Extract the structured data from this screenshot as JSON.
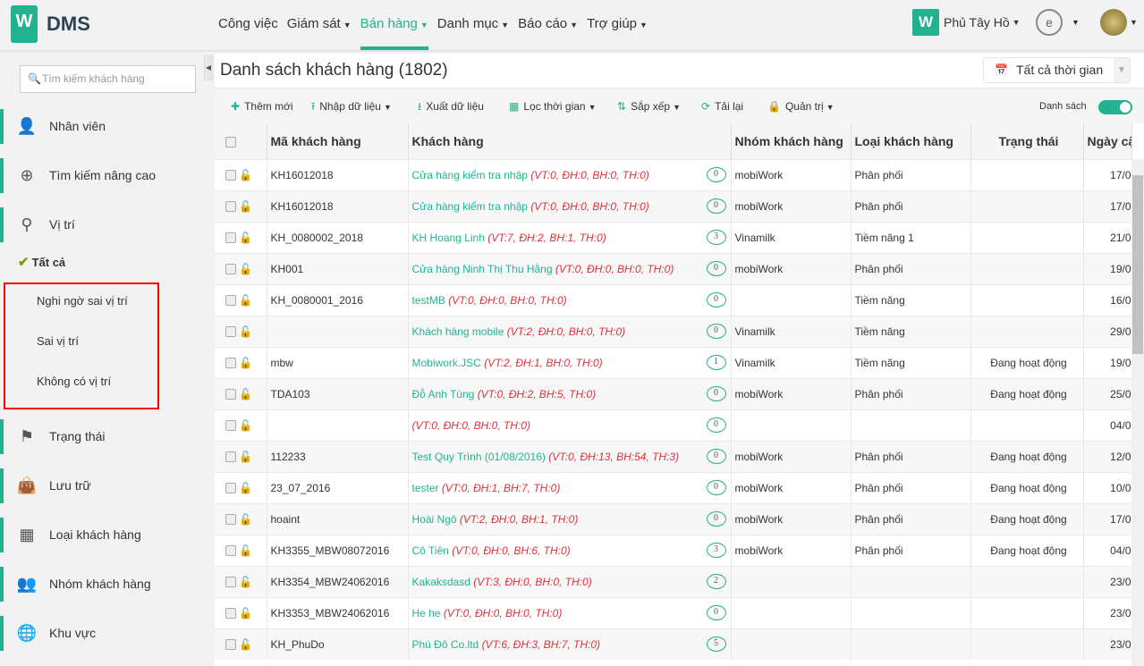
{
  "app": {
    "logo_letter": "W",
    "name": "DMS"
  },
  "nav": [
    {
      "label": "Công việc",
      "dropdown": false
    },
    {
      "label": "Giám sát",
      "dropdown": true
    },
    {
      "label": "Bán hàng",
      "dropdown": true,
      "active": true
    },
    {
      "label": "Danh mục",
      "dropdown": true
    },
    {
      "label": "Báo cáo",
      "dropdown": true
    },
    {
      "label": "Trợ giúp",
      "dropdown": true
    }
  ],
  "account": {
    "company": "Phủ Tây Hồ",
    "partner_logo": "eKGIS_JSC"
  },
  "sidebar": {
    "search_placeholder": "Tìm kiếm khách hàng",
    "items": [
      {
        "label": "Nhân viên",
        "icon": "user-icon"
      },
      {
        "label": "Tìm kiếm nâng cao",
        "icon": "zoom-in-icon"
      },
      {
        "label": "Vị trí",
        "icon": "map-marker-icon"
      },
      {
        "label": "Trạng thái",
        "icon": "flag-icon"
      },
      {
        "label": "Lưu trữ",
        "icon": "shopping-bag-icon"
      },
      {
        "label": "Loại khách hàng",
        "icon": "grid-icon"
      },
      {
        "label": "Nhóm khách hàng",
        "icon": "users-icon"
      },
      {
        "label": "Khu vực",
        "icon": "globe-icon"
      }
    ],
    "location_all": "Tất cả",
    "location_sub": [
      "Nghi ngờ sai vị trí",
      "Sai vị trí",
      "Không có vị trí"
    ]
  },
  "main": {
    "title": "Danh sách khách hàng (1802)",
    "time_filter": "Tất cả thời gian",
    "toolbar": {
      "add": "Thêm mới",
      "import": "Nhập dữ liệu",
      "export": "Xuất dữ liệu",
      "time": "Lọc thời gian",
      "sort": "Sắp xếp",
      "reload": "Tải lại",
      "admin": "Quản trị",
      "list_toggle": "Danh sách",
      "list_toggle_on": true
    },
    "columns": [
      "Mã khách hàng",
      "Khách hàng",
      "Nhóm khách hàng",
      "Loại khách hàng",
      "Trạng thái",
      "Ngày cậ"
    ],
    "rows": [
      {
        "code": "KH16012018",
        "name": "Cửa hàng kiểm tra nhập",
        "stats": "(VT:0, ĐH:0, BH:0, TH:0)",
        "comments": "0",
        "group": "mobiWork",
        "type": "Phân phối",
        "status": "",
        "date": "17/0"
      },
      {
        "code": "KH16012018",
        "name": "Cửa hàng kiểm tra nhập",
        "stats": "(VT:0, ĐH:0, BH:0, TH:0)",
        "comments": "0",
        "group": "mobiWork",
        "type": "Phân phối",
        "status": "",
        "date": "17/0"
      },
      {
        "code": "KH_0080002_2018",
        "name": "KH Hoang Linh",
        "stats": "(VT:7, ĐH:2, BH:1, TH:0)",
        "comments": "3",
        "group": "Vinamilk",
        "type": "Tiềm năng 1",
        "status": "",
        "date": "21/0"
      },
      {
        "code": "KH001",
        "name": "Cửa hàng Ninh Thị Thu Hằng",
        "stats": "(VT:0, ĐH:0, BH:0, TH:0)",
        "comments": "0",
        "group": "mobiWork",
        "type": "Phân phối",
        "status": "",
        "date": "19/0"
      },
      {
        "code": "KH_0080001_2016",
        "name": "testMB",
        "stats": "(VT:0, ĐH:0, BH:0, TH:0)",
        "comments": "0",
        "group": "",
        "type": "Tiềm năng",
        "status": "",
        "date": "16/0"
      },
      {
        "code": "",
        "name": "Khách hàng mobile",
        "stats": "(VT:2, ĐH:0, BH:0, TH:0)",
        "comments": "0",
        "group": "Vinamilk",
        "type": "Tiềm năng",
        "status": "",
        "date": "29/0"
      },
      {
        "code": "mbw",
        "name": "Mobiwork.JSC",
        "stats": "(VT:2, ĐH:1, BH:0, TH:0)",
        "comments": "1",
        "group": "Vinamilk",
        "type": "Tiềm năng",
        "status": "Đang hoạt động",
        "date": "19/0"
      },
      {
        "code": "TDA103",
        "name": "Đỗ Anh Tùng",
        "stats": "(VT:0, ĐH:2, BH:5, TH:0)",
        "comments": "0",
        "group": "mobiWork",
        "type": "Phân phối",
        "status": "Đang hoạt động",
        "date": "25/0"
      },
      {
        "code": "",
        "name": "",
        "stats": "(VT:0, ĐH:0, BH:0, TH:0)",
        "comments": "0",
        "group": "",
        "type": "",
        "status": "",
        "date": "04/0"
      },
      {
        "code": "112233",
        "name": "Test Quy Trình (01/08/2016)",
        "stats": "(VT:0, ĐH:13, BH:54, TH:3)",
        "comments": "0",
        "group": "mobiWork",
        "type": "Phân phối",
        "status": "Đang hoạt động",
        "date": "12/0"
      },
      {
        "code": "23_07_2016",
        "name": "tester",
        "stats": "(VT:0, ĐH:1, BH:7, TH:0)",
        "comments": "0",
        "group": "mobiWork",
        "type": "Phân phối",
        "status": "Đang hoạt động",
        "date": "10/0"
      },
      {
        "code": "hoaint",
        "name": "Hoài Ngô",
        "stats": "(VT:2, ĐH:0, BH:1, TH:0)",
        "comments": "0",
        "group": "mobiWork",
        "type": "Phân phối",
        "status": "Đang hoạt động",
        "date": "17/0"
      },
      {
        "code": "KH3355_MBW08072016",
        "name": "Cô Tiên",
        "stats": "(VT:0, ĐH:0, BH:6, TH:0)",
        "comments": "3",
        "group": "mobiWork",
        "type": "Phân phối",
        "status": "Đang hoạt động",
        "date": "04/0"
      },
      {
        "code": "KH3354_MBW24062016",
        "name": "Kakaksdasd",
        "stats": "(VT:3, ĐH:0, BH:0, TH:0)",
        "comments": "2",
        "group": "",
        "type": "",
        "status": "",
        "date": "23/0"
      },
      {
        "code": "KH3353_MBW24062016",
        "name": "He he",
        "stats": "(VT:0, ĐH:0, BH:0, TH:0)",
        "comments": "0",
        "group": "",
        "type": "",
        "status": "",
        "date": "23/0"
      },
      {
        "code": "KH_PhuDo",
        "name": "Phú Đô Co.ltd",
        "stats": "(VT:6, ĐH:3, BH:7, TH:0)",
        "comments": "5",
        "group": "",
        "type": "",
        "status": "",
        "date": "23/0"
      }
    ]
  },
  "colors": {
    "accent": "#23b28f",
    "stats": "#e0313a",
    "highlight_box": "#ff0000",
    "lock": "#2a6f9c"
  }
}
